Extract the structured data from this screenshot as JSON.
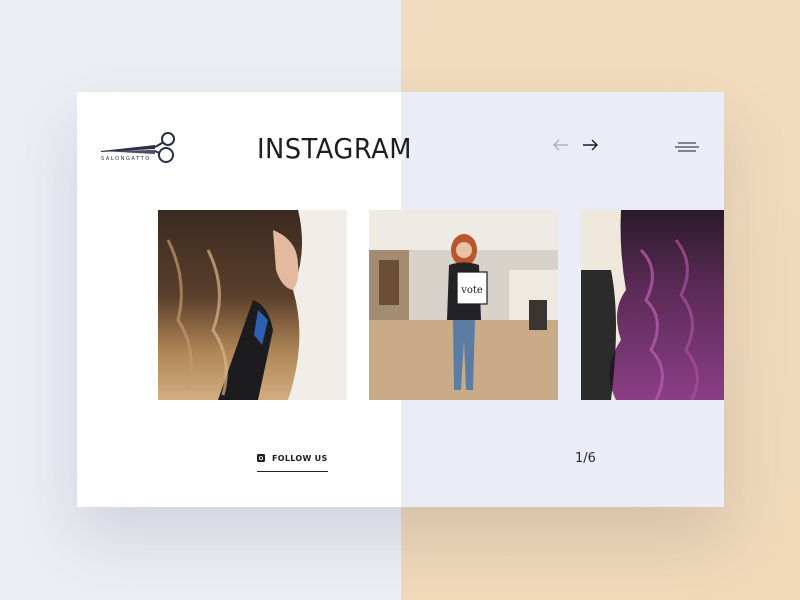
{
  "brand": {
    "name": "SALONGATTO",
    "logo_icon": "scissors-icon"
  },
  "header": {
    "title": "INSTAGRAM"
  },
  "nav": {
    "prev_icon": "arrow-left-icon",
    "next_icon": "arrow-right-icon",
    "menu_icon": "hamburger-icon"
  },
  "gallery": {
    "items": [
      {
        "subject": "brunette balayage waves"
      },
      {
        "subject": "woman holding vote sign in salon",
        "sign_text": "vote"
      },
      {
        "subject": "purple curls"
      }
    ]
  },
  "footer": {
    "follow_label": "FOLLOW US",
    "follow_icon": "instagram-icon",
    "page_counter": "1/6"
  },
  "colors": {
    "accent_left": "#eceef5",
    "accent_right": "#f2dcbf",
    "card": "#ffffff",
    "card_tint": "#eaecf6",
    "ink": "#1d1d22"
  }
}
